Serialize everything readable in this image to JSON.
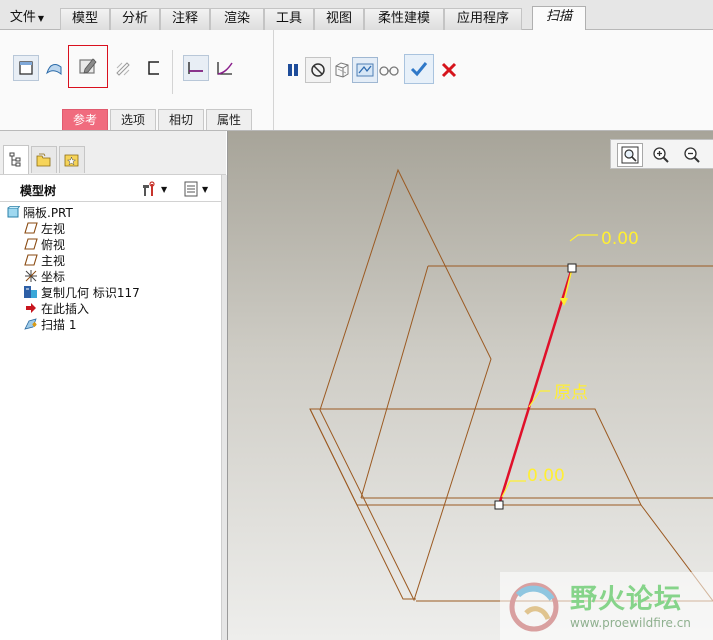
{
  "menu": {
    "file": "文件",
    "tabs": [
      "模型",
      "分析",
      "注释",
      "渲染",
      "工具",
      "视图",
      "柔性建模",
      "应用程序"
    ],
    "active": "扫描"
  },
  "ribbon": {
    "subtabs": [
      "参考",
      "选项",
      "相切",
      "属性"
    ],
    "active_subtab": "参考"
  },
  "tree": {
    "title": "模型树",
    "items": [
      {
        "label": "隔板.PRT",
        "icon": "part-icon"
      },
      {
        "label": "左视",
        "icon": "datum-plane-icon"
      },
      {
        "label": "俯视",
        "icon": "datum-plane-icon"
      },
      {
        "label": "主视",
        "icon": "datum-plane-icon"
      },
      {
        "label": "坐标",
        "icon": "coordinate-system-icon"
      },
      {
        "label": "复制几何 标识117",
        "icon": "copy-geometry-icon"
      },
      {
        "label": "在此插入",
        "icon": "insert-here-arrow-icon"
      },
      {
        "label": "扫描 1",
        "icon": "sweep-feature-icon"
      }
    ]
  },
  "viewport": {
    "dim_top": "0.00",
    "dim_origin": "原点",
    "dim_bottom": "0.00"
  },
  "watermark": {
    "text": "野火论坛",
    "url": "www.proewildfire.cn"
  },
  "colors": {
    "accent_red": "#d9101e",
    "subtab_active": "#f06b7e",
    "wire": "#9b5a22",
    "dimension": "#ffef33",
    "trajectory": "#e0102a",
    "confirm_blue": "#2f78c8",
    "cancel_red": "#d6141c",
    "wm_green": "#86d48a"
  }
}
